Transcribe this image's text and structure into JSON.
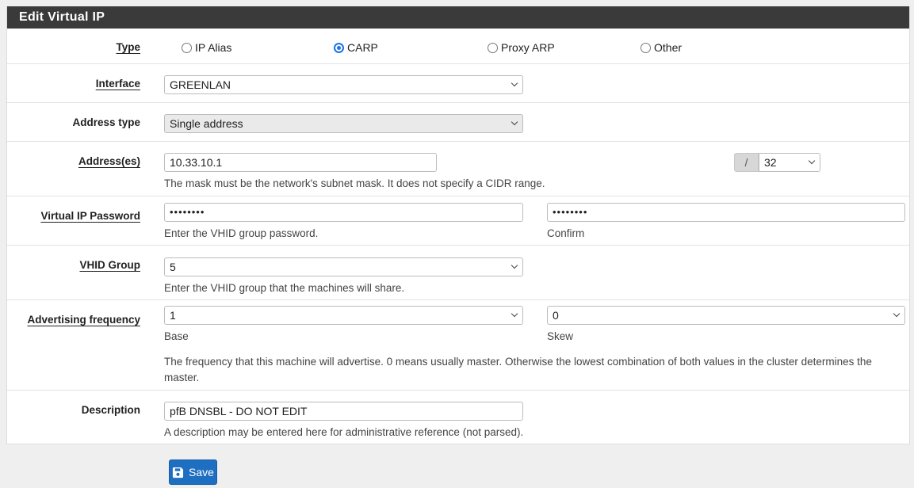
{
  "panel": {
    "title": "Edit Virtual IP"
  },
  "type": {
    "label": "Type",
    "options": [
      {
        "label": "IP Alias",
        "selected": false
      },
      {
        "label": "CARP",
        "selected": true
      },
      {
        "label": "Proxy ARP",
        "selected": false
      },
      {
        "label": "Other",
        "selected": false
      }
    ]
  },
  "interface": {
    "label": "Interface",
    "value": "GREENLAN"
  },
  "address_type": {
    "label": "Address type",
    "value": "Single address"
  },
  "addresses": {
    "label": "Address(es)",
    "value": "10.33.10.1",
    "slash": "/",
    "mask": "32",
    "help": "The mask must be the network's subnet mask. It does not specify a CIDR range."
  },
  "vip_password": {
    "label": "Virtual IP Password",
    "value": "••••••••",
    "confirm_value": "••••••••",
    "help": "Enter the VHID group password.",
    "confirm_help": "Confirm"
  },
  "vhid_group": {
    "label": "VHID Group",
    "value": "5",
    "help": "Enter the VHID group that the machines will share."
  },
  "advertising": {
    "label": "Advertising frequency",
    "base_value": "1",
    "skew_value": "0",
    "base_help": "Base",
    "skew_help": "Skew",
    "help": "The frequency that this machine will advertise. 0 means usually master. Otherwise the lowest combination of both values in the cluster determines the master."
  },
  "description": {
    "label": "Description",
    "value": "pfB DNSBL - DO NOT EDIT",
    "help": "A description may be entered here for administrative reference (not parsed)."
  },
  "save_button": {
    "label": "Save",
    "icon": "floppy-disk-icon"
  },
  "colors": {
    "accent": "#1a73e8",
    "header": "#3a3a3a",
    "save": "#1e6fc1"
  }
}
